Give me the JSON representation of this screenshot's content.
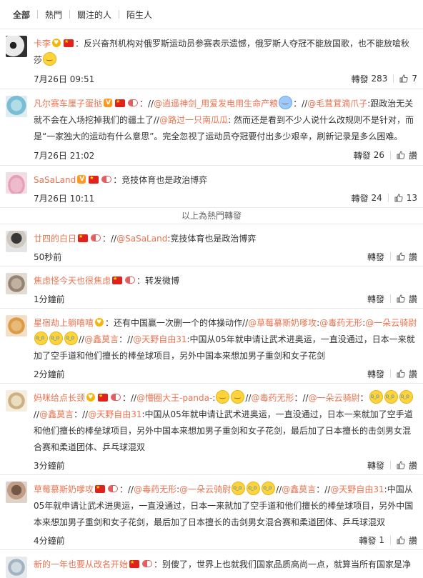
{
  "tabs": [
    "全部",
    "熱門",
    "關注的人",
    "陌生人"
  ],
  "hot_divider": "以上為熱門轉發",
  "colors": {
    "link": "#eb7350",
    "flag": "#e2211c"
  },
  "items": [
    {
      "user": "卡李",
      "text_prefix": "：反兴奋剂机构对俄罗斯运动员参赛表示遗憾，俄罗斯人夺冠不能放国歌，也不能放嗆秋莎",
      "time": "7月26日 09:51",
      "repost_label": "轉發",
      "repost_count": "283",
      "like_count": "7"
    },
    {
      "user": "凡尔赛车厘子蛋挞",
      "seg1": "：//",
      "m1": "@逍遥神剑_用爱发电用生命产粮",
      "seg2": "：//",
      "m2": "@毛茸茸滴爪子",
      "seg3": ":跟政治无关就不会在入场挖掉我们的疆土了//",
      "m3": "@路过一只南瓜瓜",
      "seg4": ": 然而还是看到不少人说什么改规则不是针对，而是“一家独大的运动有什么意思”。完全忽视了运动员夺冠要付出多少艰辛，刷新记录是多么困难。",
      "time": "7月26日 21:02",
      "repost_label": "轉發",
      "repost_count": "26",
      "like_label": "讚"
    },
    {
      "user": "SaSaLand",
      "text": "：竞技体育也是政治博弈",
      "time": "7月26日 10:11",
      "repost_label": "轉發",
      "repost_count": "24",
      "like_count": "13"
    },
    {
      "user": "廿四的白日",
      "seg1": "：//",
      "m1": "@SaSaLand",
      "seg2": ":竞技体育也是政治博弈",
      "time": "50秒前",
      "repost_label": "轉發",
      "like_label": "讚"
    },
    {
      "user": "焦虑怪今天也很焦虑",
      "text": "：转发微博",
      "time": "1分鐘前",
      "repost_label": "轉發",
      "like_label": "讚"
    },
    {
      "user": "星宿劫上躺嘻嘻",
      "seg1": "：还有中国赢一次删一个的体操动作",
      "seg2": "//",
      "m1": "@草莓慕斯奶嗲攻",
      "seg3": ":",
      "m2": "@毒药无形",
      "seg4": ":",
      "m3": "@一朵云骑尉",
      "seg5": "//",
      "m4": "@鑫莫言",
      "seg6": "：//",
      "m5": "@天野自由31",
      "seg7": ":中国从05年就申请让武术进奥运，一直没通过，日本一来就加了空手道和他们擅长的棒垒球项目，另外中国本来想加男子重剑和女子花剑",
      "time": "2分鐘前",
      "repost_label": "轉發",
      "like_label": "讚"
    },
    {
      "user": "妈咪给点长颈",
      "seg1": "：//",
      "m1": "@懵圈大王-panda-",
      "seg2": ":",
      "seg3": "//",
      "m2": "@毒药无形",
      "seg4": "：//",
      "m3": "@一朵云骑尉",
      "seg5": "：",
      "seg6": "//",
      "m4": "@鑫莫言",
      "seg7": "：//",
      "m5": "@天野自由31",
      "seg8": ":中国从05年就申请让武术进奥运，一直没通过，日本一来就加了空手道和他们擅长的棒垒球项目，另外中国本来想加男子重剑和女子花剑，最后加了日本擅长的击剑男女混合赛和柔道团体、乒乓球混双",
      "time": "3分鐘前",
      "repost_label": "轉發",
      "like_label": "讚"
    },
    {
      "user": "草莓慕斯奶嗲攻",
      "seg1": "：//",
      "m1": "@毒药无形",
      "seg2": ":",
      "m2": "@一朵云骑尉",
      "seg3": "//",
      "m3": "@鑫莫言",
      "seg4": "：//",
      "m4": "@天野自由31",
      "seg5": ":中国从05年就申请让武术进奥运，一直没通过，日本一来就加了空手道和他们擅长的棒垒球项目，另外中国本来想加男子重剑和女子花剑，最后加了日本擅长的击剑男女混合赛和柔道团体、乒乓球混双",
      "time": "4分鐘前",
      "repost_label": "轉發",
      "repost_count": "1",
      "like_label": "讚"
    },
    {
      "user": "新的一年也要从改名开始",
      "text": "：别傻了，世界上也就我们国家品质高尚一点，就算当所有国家是净",
      "time": ""
    }
  ]
}
